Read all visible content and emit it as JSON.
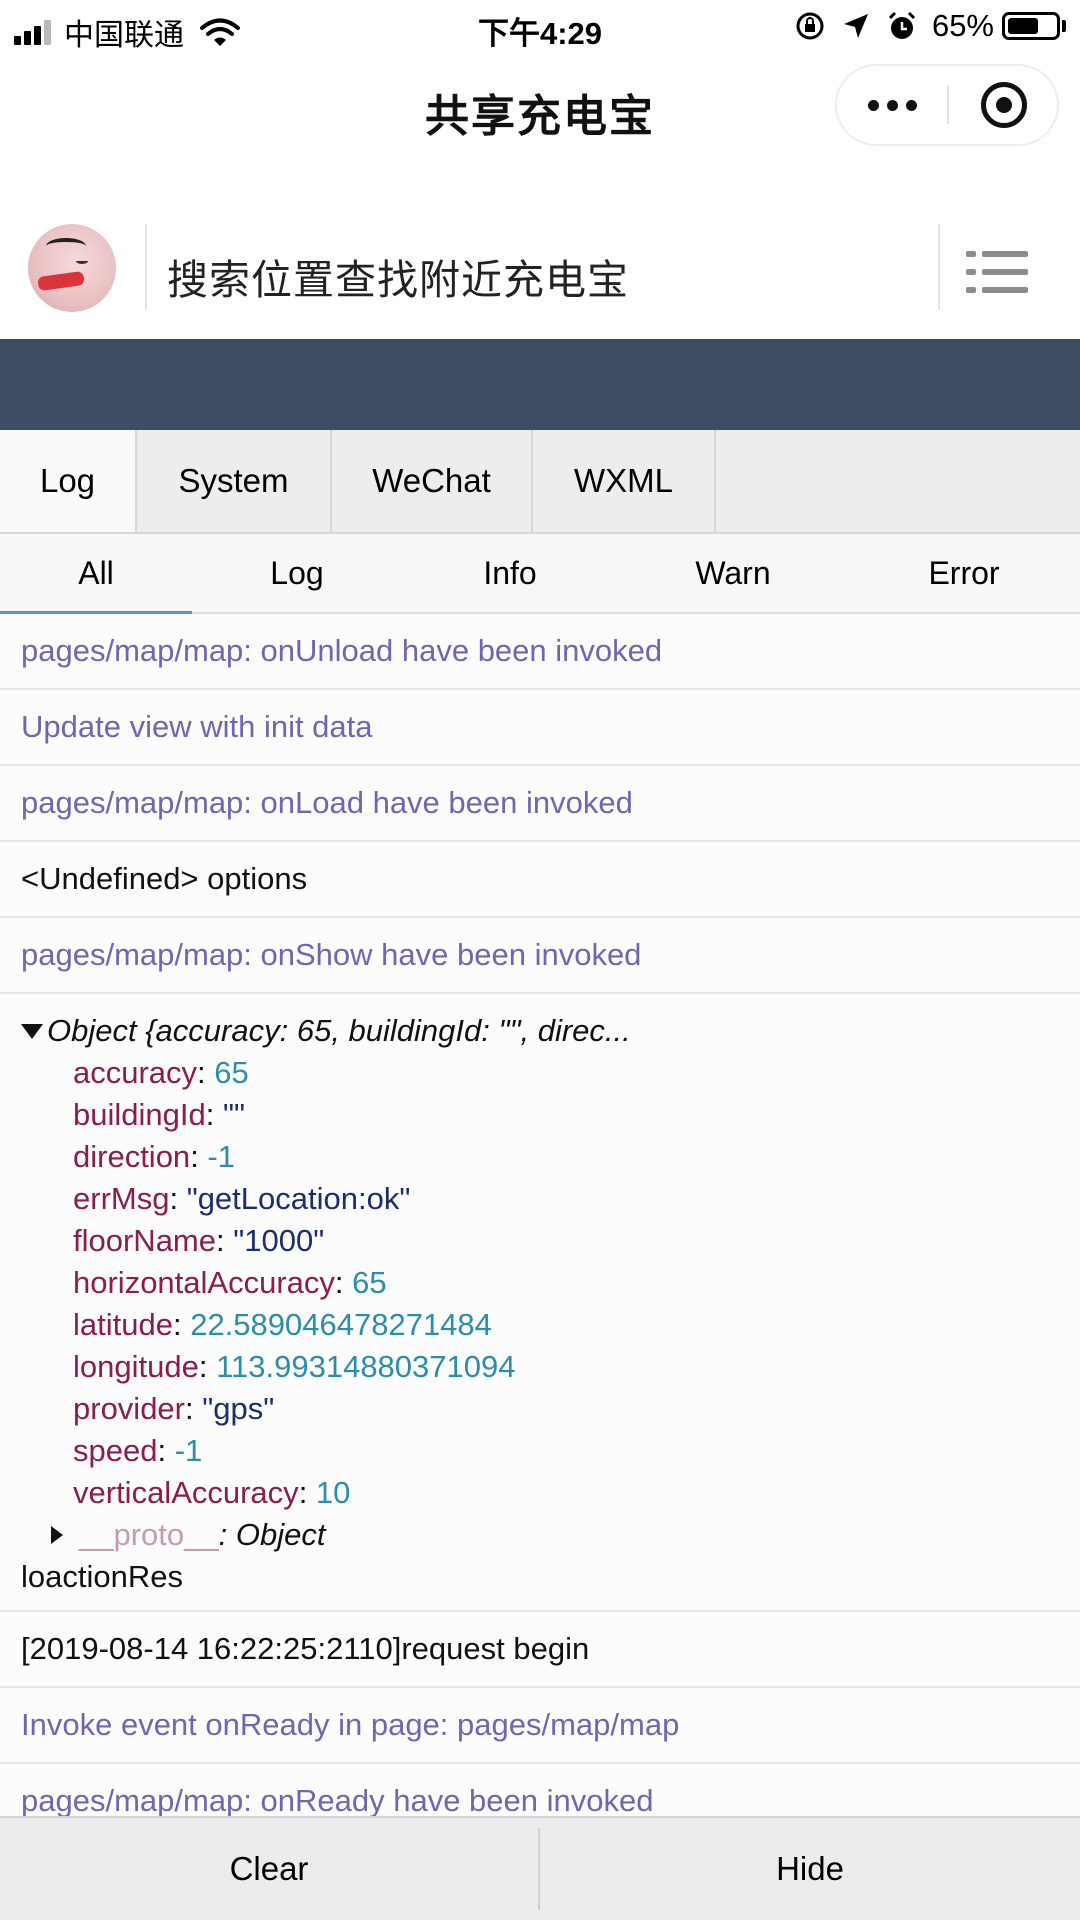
{
  "status_bar": {
    "carrier": "中国联通",
    "time": "下午4:29",
    "battery_percent": "65%",
    "battery_level": 0.65,
    "icons": [
      "signal-icon",
      "wifi-icon",
      "rotation-lock-icon",
      "location-arrow-icon",
      "alarm-icon",
      "battery-icon"
    ]
  },
  "nav": {
    "title": "共享充电宝",
    "capsule_icons": [
      "more-icon",
      "close-target-icon"
    ]
  },
  "search": {
    "placeholder": "搜索位置查找附近充电宝"
  },
  "colors": {
    "dark_band": "#3d4d63",
    "system_log": "#6e67b0",
    "key": "#8a1c4f",
    "number": "#2a8fa6",
    "string": "#1c2d6e",
    "active_underline": "#6a8ccc"
  },
  "vconsole": {
    "tabs": [
      "Log",
      "System",
      "WeChat",
      "WXML"
    ],
    "active_tab": "Log",
    "filters": [
      "All",
      "Log",
      "Info",
      "Warn",
      "Error"
    ],
    "active_filter": "All",
    "logs": [
      "pages/map/map: onUnload have been invoked",
      "Update view with init data",
      "pages/map/map: onLoad have been invoked",
      "<Undefined> options",
      "pages/map/map: onShow have been invoked"
    ],
    "object": {
      "summary": "Object {accuracy: 65, buildingId: \"\", direc...",
      "props": [
        {
          "key": "accuracy",
          "value": "65"
        },
        {
          "key": "buildingId",
          "value": "\"\""
        },
        {
          "key": "direction",
          "value": "-1"
        },
        {
          "key": "errMsg",
          "value": "\"getLocation:ok\""
        },
        {
          "key": "floorName",
          "value": "\"1000\""
        },
        {
          "key": "horizontalAccuracy",
          "value": "65"
        },
        {
          "key": "latitude",
          "value": "22.589046478271484"
        },
        {
          "key": "longitude",
          "value": "113.99314880371094"
        },
        {
          "key": "provider",
          "value": "\"gps\""
        },
        {
          "key": "speed",
          "value": "-1"
        },
        {
          "key": "verticalAccuracy",
          "value": "10"
        }
      ],
      "proto_key": "__proto__",
      "proto_value": ": Object",
      "tail": "loactionRes"
    },
    "logs_after": [
      "[2019-08-14 16:22:25:2110]request begin",
      "Invoke event onReady in page: pages/map/map",
      "pages/map/map: onReady have been invoked"
    ],
    "footer": {
      "clear_label": "Clear",
      "hide_label": "Hide"
    }
  }
}
